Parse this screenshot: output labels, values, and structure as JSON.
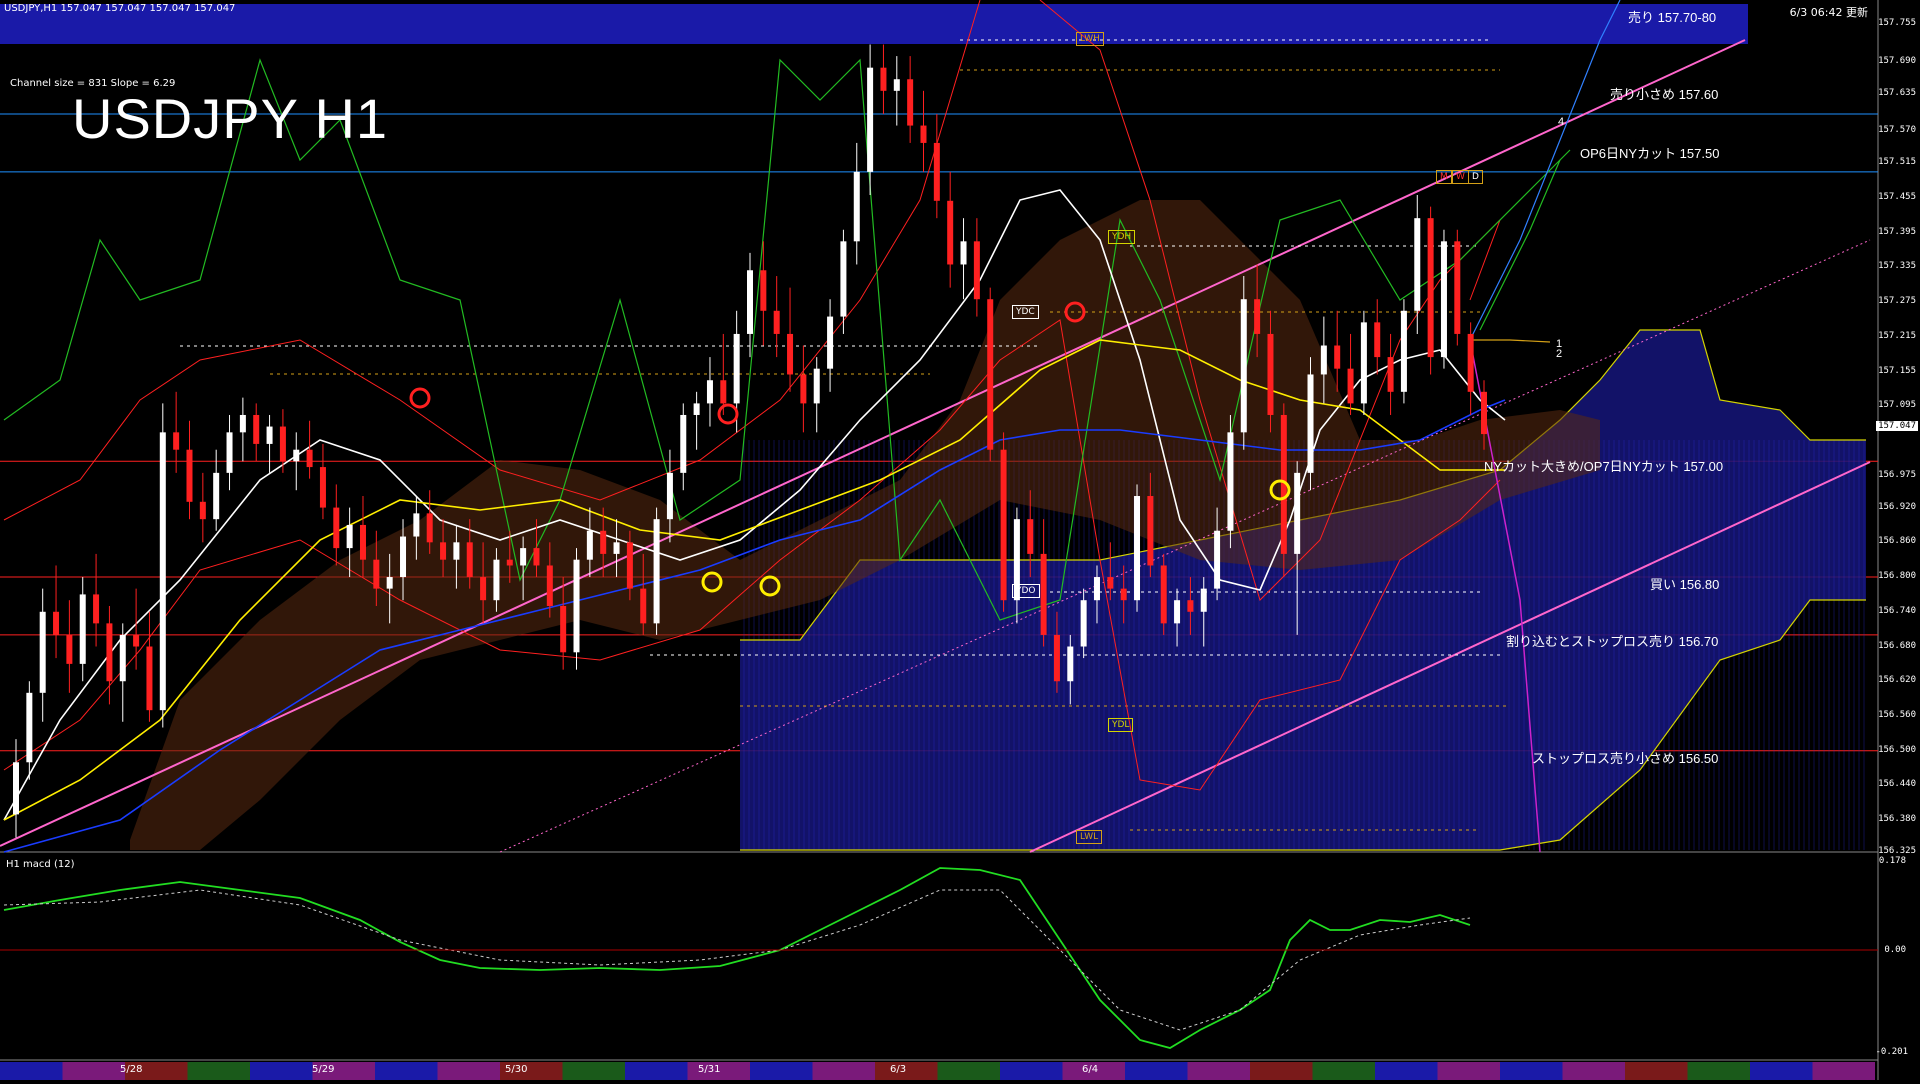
{
  "header": {
    "symbol_info": "USDJPY,H1  157.047 157.047 157.047 157.047",
    "timestamp": "6/3 06:42 更新",
    "title": "USDJPY H1",
    "channel_info": "Channel size = 831 Slope = 6.29"
  },
  "levels": [
    {
      "label": "売り 157.70-80",
      "price": 157.75,
      "color": "#1a1aa8",
      "style": "band"
    },
    {
      "label": "売り小さめ 157.60",
      "price": 157.6,
      "color": "#1e90ff",
      "style": "line"
    },
    {
      "label": "OP6日NYカット 157.50",
      "price": 157.5,
      "color": "#1e90ff",
      "style": "line"
    },
    {
      "label": "NYカット大きめ/OP7日NYカット 157.00",
      "price": 157.0,
      "color": "#ff2020",
      "style": "line"
    },
    {
      "label": "買い 156.80",
      "price": 156.8,
      "color": "#ff2020",
      "style": "line"
    },
    {
      "label": "割り込むとストップロス売り 156.70",
      "price": 156.7,
      "color": "#ff2020",
      "style": "line"
    },
    {
      "label": "ストップロス売り小さめ 156.50",
      "price": 156.5,
      "color": "#ff2020",
      "style": "line"
    }
  ],
  "markers": [
    {
      "label": "LWH",
      "color": "#d4a017"
    },
    {
      "label": "YDH",
      "color": "#d4d400"
    },
    {
      "label": "YDC",
      "color": "#ffffff"
    },
    {
      "label": "YDO",
      "color": "#ffffff"
    },
    {
      "label": "YDL",
      "color": "#d4d400"
    },
    {
      "label": "LWL",
      "color": "#d4a017"
    }
  ],
  "channel_labels": [
    "1",
    "2",
    "4"
  ],
  "mwd": [
    "M",
    "W",
    "D"
  ],
  "current_price": "157.047",
  "macd": {
    "label": "H1  macd (12)",
    "ticks": [
      "0.178",
      "0.00",
      "-0.201"
    ]
  },
  "date_labels": [
    "5/28",
    "5/29",
    "5/30",
    "5/31",
    "6/3",
    "6/4"
  ],
  "axis_ticks": [
    "157.755",
    "157.690",
    "157.635",
    "157.570",
    "157.515",
    "157.455",
    "157.395",
    "157.335",
    "157.275",
    "157.215",
    "157.155",
    "157.095",
    "156.975",
    "156.920",
    "156.860",
    "156.800",
    "156.740",
    "156.680",
    "156.620",
    "156.560",
    "156.500",
    "156.440",
    "156.380",
    "156.325"
  ],
  "chart_data": {
    "type": "line",
    "title": "USDJPY H1",
    "ylim": [
      156.325,
      157.79
    ],
    "ylabel": "",
    "xlabel": "",
    "candles": [
      {
        "o": 156.39,
        "h": 156.52,
        "l": 156.35,
        "c": 156.48
      },
      {
        "o": 156.48,
        "h": 156.62,
        "l": 156.45,
        "c": 156.6
      },
      {
        "o": 156.6,
        "h": 156.78,
        "l": 156.55,
        "c": 156.74
      },
      {
        "o": 156.74,
        "h": 156.82,
        "l": 156.66,
        "c": 156.7
      },
      {
        "o": 156.7,
        "h": 156.76,
        "l": 156.6,
        "c": 156.65
      },
      {
        "o": 156.65,
        "h": 156.8,
        "l": 156.62,
        "c": 156.77
      },
      {
        "o": 156.77,
        "h": 156.84,
        "l": 156.68,
        "c": 156.72
      },
      {
        "o": 156.72,
        "h": 156.75,
        "l": 156.58,
        "c": 156.62
      },
      {
        "o": 156.62,
        "h": 156.72,
        "l": 156.55,
        "c": 156.7
      },
      {
        "o": 156.7,
        "h": 156.78,
        "l": 156.64,
        "c": 156.68
      },
      {
        "o": 156.68,
        "h": 156.74,
        "l": 156.55,
        "c": 156.57
      },
      {
        "o": 156.57,
        "h": 157.1,
        "l": 156.54,
        "c": 157.05
      },
      {
        "o": 157.05,
        "h": 157.12,
        "l": 156.98,
        "c": 157.02
      },
      {
        "o": 157.02,
        "h": 157.07,
        "l": 156.9,
        "c": 156.93
      },
      {
        "o": 156.93,
        "h": 156.98,
        "l": 156.86,
        "c": 156.9
      },
      {
        "o": 156.9,
        "h": 157.02,
        "l": 156.88,
        "c": 156.98
      },
      {
        "o": 156.98,
        "h": 157.08,
        "l": 156.95,
        "c": 157.05
      },
      {
        "o": 157.05,
        "h": 157.11,
        "l": 157.0,
        "c": 157.08
      },
      {
        "o": 157.08,
        "h": 157.1,
        "l": 157.0,
        "c": 157.03
      },
      {
        "o": 157.03,
        "h": 157.08,
        "l": 156.98,
        "c": 157.06
      },
      {
        "o": 157.06,
        "h": 157.09,
        "l": 156.98,
        "c": 157.0
      },
      {
        "o": 157.0,
        "h": 157.05,
        "l": 156.95,
        "c": 157.02
      },
      {
        "o": 157.02,
        "h": 157.07,
        "l": 156.97,
        "c": 156.99
      },
      {
        "o": 156.99,
        "h": 157.03,
        "l": 156.9,
        "c": 156.92
      },
      {
        "o": 156.92,
        "h": 156.96,
        "l": 156.82,
        "c": 156.85
      },
      {
        "o": 156.85,
        "h": 156.92,
        "l": 156.8,
        "c": 156.89
      },
      {
        "o": 156.89,
        "h": 156.94,
        "l": 156.8,
        "c": 156.83
      },
      {
        "o": 156.83,
        "h": 156.88,
        "l": 156.75,
        "c": 156.78
      },
      {
        "o": 156.78,
        "h": 156.84,
        "l": 156.72,
        "c": 156.8
      },
      {
        "o": 156.8,
        "h": 156.9,
        "l": 156.76,
        "c": 156.87
      },
      {
        "o": 156.87,
        "h": 156.94,
        "l": 156.83,
        "c": 156.91
      },
      {
        "o": 156.91,
        "h": 156.95,
        "l": 156.84,
        "c": 156.86
      },
      {
        "o": 156.86,
        "h": 156.9,
        "l": 156.8,
        "c": 156.83
      },
      {
        "o": 156.83,
        "h": 156.89,
        "l": 156.78,
        "c": 156.86
      },
      {
        "o": 156.86,
        "h": 156.9,
        "l": 156.78,
        "c": 156.8
      },
      {
        "o": 156.8,
        "h": 156.86,
        "l": 156.72,
        "c": 156.76
      },
      {
        "o": 156.76,
        "h": 156.85,
        "l": 156.74,
        "c": 156.83
      },
      {
        "o": 156.83,
        "h": 156.88,
        "l": 156.79,
        "c": 156.82
      },
      {
        "o": 156.82,
        "h": 156.87,
        "l": 156.76,
        "c": 156.85
      },
      {
        "o": 156.85,
        "h": 156.9,
        "l": 156.8,
        "c": 156.82
      },
      {
        "o": 156.82,
        "h": 156.86,
        "l": 156.73,
        "c": 156.75
      },
      {
        "o": 156.75,
        "h": 156.8,
        "l": 156.64,
        "c": 156.67
      },
      {
        "o": 156.67,
        "h": 156.85,
        "l": 156.64,
        "c": 156.83
      },
      {
        "o": 156.83,
        "h": 156.92,
        "l": 156.8,
        "c": 156.88
      },
      {
        "o": 156.88,
        "h": 156.92,
        "l": 156.8,
        "c": 156.84
      },
      {
        "o": 156.84,
        "h": 156.9,
        "l": 156.8,
        "c": 156.86
      },
      {
        "o": 156.86,
        "h": 156.88,
        "l": 156.76,
        "c": 156.78
      },
      {
        "o": 156.78,
        "h": 156.84,
        "l": 156.7,
        "c": 156.72
      },
      {
        "o": 156.72,
        "h": 156.92,
        "l": 156.7,
        "c": 156.9
      },
      {
        "o": 156.9,
        "h": 157.02,
        "l": 156.86,
        "c": 156.98
      },
      {
        "o": 156.98,
        "h": 157.1,
        "l": 156.95,
        "c": 157.08
      },
      {
        "o": 157.08,
        "h": 157.12,
        "l": 157.02,
        "c": 157.1
      },
      {
        "o": 157.1,
        "h": 157.18,
        "l": 157.06,
        "c": 157.14
      },
      {
        "o": 157.14,
        "h": 157.22,
        "l": 157.08,
        "c": 157.1
      },
      {
        "o": 157.1,
        "h": 157.26,
        "l": 157.05,
        "c": 157.22
      },
      {
        "o": 157.22,
        "h": 157.36,
        "l": 157.18,
        "c": 157.33
      },
      {
        "o": 157.33,
        "h": 157.38,
        "l": 157.2,
        "c": 157.26
      },
      {
        "o": 157.26,
        "h": 157.32,
        "l": 157.18,
        "c": 157.22
      },
      {
        "o": 157.22,
        "h": 157.3,
        "l": 157.12,
        "c": 157.15
      },
      {
        "o": 157.15,
        "h": 157.2,
        "l": 157.05,
        "c": 157.1
      },
      {
        "o": 157.1,
        "h": 157.18,
        "l": 157.05,
        "c": 157.16
      },
      {
        "o": 157.16,
        "h": 157.28,
        "l": 157.12,
        "c": 157.25
      },
      {
        "o": 157.25,
        "h": 157.4,
        "l": 157.22,
        "c": 157.38
      },
      {
        "o": 157.38,
        "h": 157.55,
        "l": 157.34,
        "c": 157.5
      },
      {
        "o": 157.5,
        "h": 157.72,
        "l": 157.46,
        "c": 157.68
      },
      {
        "o": 157.68,
        "h": 157.72,
        "l": 157.6,
        "c": 157.64
      },
      {
        "o": 157.64,
        "h": 157.7,
        "l": 157.58,
        "c": 157.66
      },
      {
        "o": 157.66,
        "h": 157.7,
        "l": 157.55,
        "c": 157.58
      },
      {
        "o": 157.58,
        "h": 157.64,
        "l": 157.5,
        "c": 157.55
      },
      {
        "o": 157.55,
        "h": 157.6,
        "l": 157.42,
        "c": 157.45
      },
      {
        "o": 157.45,
        "h": 157.5,
        "l": 157.3,
        "c": 157.34
      },
      {
        "o": 157.34,
        "h": 157.42,
        "l": 157.28,
        "c": 157.38
      },
      {
        "o": 157.38,
        "h": 157.42,
        "l": 157.25,
        "c": 157.28
      },
      {
        "o": 157.28,
        "h": 157.3,
        "l": 157.0,
        "c": 157.02
      },
      {
        "o": 157.02,
        "h": 157.05,
        "l": 156.74,
        "c": 156.76
      },
      {
        "o": 156.76,
        "h": 156.92,
        "l": 156.72,
        "c": 156.9
      },
      {
        "o": 156.9,
        "h": 156.95,
        "l": 156.8,
        "c": 156.84
      },
      {
        "o": 156.84,
        "h": 156.9,
        "l": 156.68,
        "c": 156.7
      },
      {
        "o": 156.7,
        "h": 156.74,
        "l": 156.6,
        "c": 156.62
      },
      {
        "o": 156.62,
        "h": 156.7,
        "l": 156.58,
        "c": 156.68
      },
      {
        "o": 156.68,
        "h": 156.78,
        "l": 156.66,
        "c": 156.76
      },
      {
        "o": 156.76,
        "h": 156.82,
        "l": 156.72,
        "c": 156.8
      },
      {
        "o": 156.8,
        "h": 156.86,
        "l": 156.76,
        "c": 156.78
      },
      {
        "o": 156.78,
        "h": 156.82,
        "l": 156.72,
        "c": 156.76
      },
      {
        "o": 156.76,
        "h": 156.96,
        "l": 156.74,
        "c": 156.94
      },
      {
        "o": 156.94,
        "h": 156.98,
        "l": 156.8,
        "c": 156.82
      },
      {
        "o": 156.82,
        "h": 156.84,
        "l": 156.7,
        "c": 156.72
      },
      {
        "o": 156.72,
        "h": 156.78,
        "l": 156.68,
        "c": 156.76
      },
      {
        "o": 156.76,
        "h": 156.8,
        "l": 156.7,
        "c": 156.74
      },
      {
        "o": 156.74,
        "h": 156.8,
        "l": 156.68,
        "c": 156.78
      },
      {
        "o": 156.78,
        "h": 156.92,
        "l": 156.76,
        "c": 156.88
      },
      {
        "o": 156.88,
        "h": 157.08,
        "l": 156.85,
        "c": 157.05
      },
      {
        "o": 157.05,
        "h": 157.32,
        "l": 157.02,
        "c": 157.28
      },
      {
        "o": 157.28,
        "h": 157.34,
        "l": 157.18,
        "c": 157.22
      },
      {
        "o": 157.22,
        "h": 157.26,
        "l": 157.05,
        "c": 157.08
      },
      {
        "o": 157.08,
        "h": 157.1,
        "l": 156.8,
        "c": 156.84
      },
      {
        "o": 156.84,
        "h": 157.0,
        "l": 156.7,
        "c": 156.98
      },
      {
        "o": 156.98,
        "h": 157.18,
        "l": 156.95,
        "c": 157.15
      },
      {
        "o": 157.15,
        "h": 157.25,
        "l": 157.1,
        "c": 157.2
      },
      {
        "o": 157.2,
        "h": 157.26,
        "l": 157.12,
        "c": 157.16
      },
      {
        "o": 157.16,
        "h": 157.22,
        "l": 157.08,
        "c": 157.1
      },
      {
        "o": 157.1,
        "h": 157.26,
        "l": 157.08,
        "c": 157.24
      },
      {
        "o": 157.24,
        "h": 157.28,
        "l": 157.15,
        "c": 157.18
      },
      {
        "o": 157.18,
        "h": 157.22,
        "l": 157.08,
        "c": 157.12
      },
      {
        "o": 157.12,
        "h": 157.28,
        "l": 157.1,
        "c": 157.26
      },
      {
        "o": 157.26,
        "h": 157.46,
        "l": 157.22,
        "c": 157.42
      },
      {
        "o": 157.42,
        "h": 157.44,
        "l": 157.15,
        "c": 157.18
      },
      {
        "o": 157.18,
        "h": 157.4,
        "l": 157.16,
        "c": 157.38
      },
      {
        "o": 157.38,
        "h": 157.4,
        "l": 157.2,
        "c": 157.22
      },
      {
        "o": 157.22,
        "h": 157.24,
        "l": 157.08,
        "c": 157.12
      },
      {
        "o": 157.12,
        "h": 157.14,
        "l": 157.02,
        "c": 157.047
      }
    ]
  }
}
